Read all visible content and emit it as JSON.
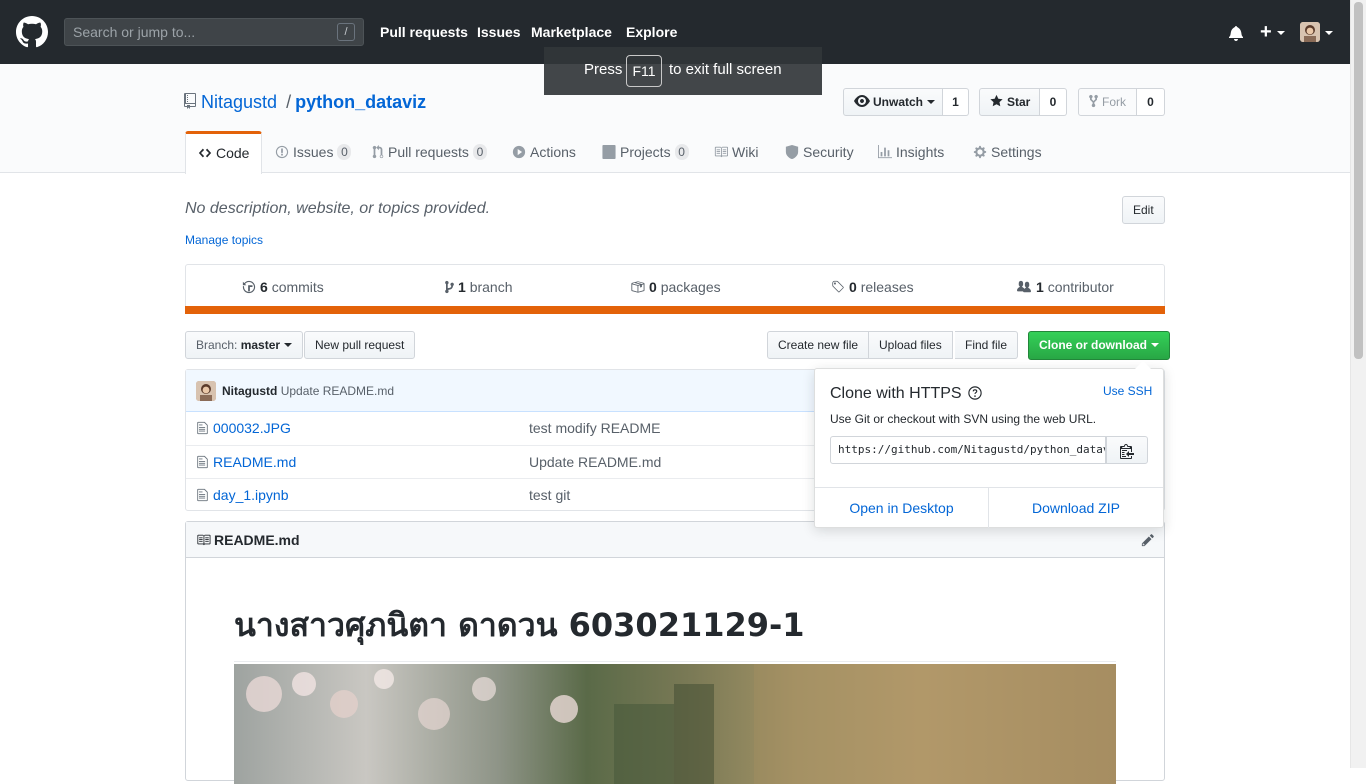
{
  "header": {
    "search_placeholder": "Search or jump to...",
    "search_shortcut": "/",
    "nav": [
      "Pull requests",
      "Issues",
      "Marketplace",
      "Explore"
    ],
    "plus": "+"
  },
  "fullscreen_toast": {
    "press": "Press",
    "key": "F11",
    "rest": "to exit full screen"
  },
  "repo": {
    "owner": "Nitagustd",
    "separator": "/",
    "name": "python_dataviz",
    "unwatch_label": "Unwatch",
    "watch_count": "1",
    "star_label": "Star",
    "star_count": "0",
    "fork_label": "Fork",
    "fork_count": "0"
  },
  "tabs": [
    {
      "label": "Code",
      "icon": "code-icon"
    },
    {
      "label": "Issues",
      "count": "0",
      "icon": "issue-icon"
    },
    {
      "label": "Pull requests",
      "count": "0",
      "icon": "pull-request-icon"
    },
    {
      "label": "Actions",
      "icon": "play-icon"
    },
    {
      "label": "Projects",
      "count": "0",
      "icon": "project-icon"
    },
    {
      "label": "Wiki",
      "icon": "book-icon"
    },
    {
      "label": "Security",
      "icon": "shield-icon"
    },
    {
      "label": "Insights",
      "icon": "graph-icon"
    },
    {
      "label": "Settings",
      "icon": "gear-icon"
    }
  ],
  "about": {
    "description": "No description, website, or topics provided.",
    "manage_topics": "Manage topics",
    "edit": "Edit"
  },
  "summary": {
    "commits_num": "6",
    "commits_label": "commits",
    "branch_num": "1",
    "branch_label": "branch",
    "packages_num": "0",
    "packages_label": "packages",
    "releases_num": "0",
    "releases_label": "releases",
    "contributor_num": "1",
    "contributor_label": "contributor",
    "bar_color": "#e36209"
  },
  "toolbar": {
    "branch_prefix": "Branch:",
    "branch_name": "master",
    "new_pr": "New pull request",
    "create_file": "Create new file",
    "upload_files": "Upload files",
    "find_file": "Find file",
    "clone": "Clone or download"
  },
  "latest_commit": {
    "author": "Nitagustd",
    "message": "Update README.md"
  },
  "files": [
    {
      "name": "000032.JPG",
      "message": "test modify README"
    },
    {
      "name": "README.md",
      "message": "Update README.md"
    },
    {
      "name": "day_1.ipynb",
      "message": "test git"
    }
  ],
  "readme": {
    "filename": "README.md",
    "heading": "นางสาวศุภนิตา ดาดวน 603021129-1"
  },
  "clone_popover": {
    "title": "Clone with HTTPS",
    "use_ssh": "Use SSH",
    "subtitle": "Use Git or checkout with SVN using the web URL.",
    "url": "https://github.com/Nitagustd/python_dataviz.git",
    "open_desktop": "Open in Desktop",
    "download_zip": "Download ZIP"
  }
}
